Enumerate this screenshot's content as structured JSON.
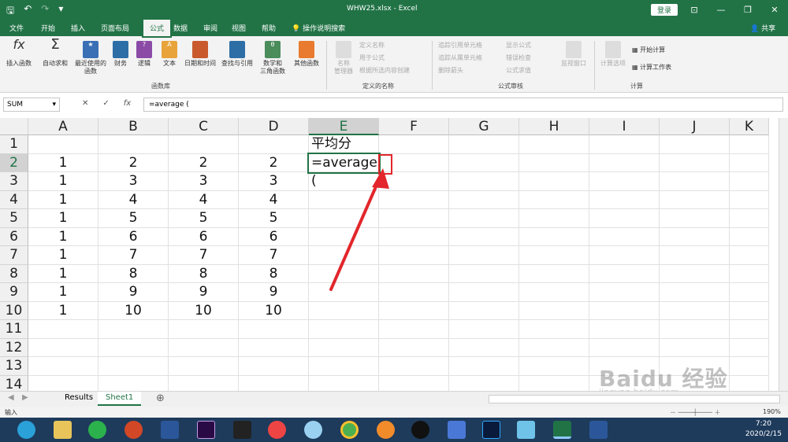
{
  "titlebar": {
    "title": "WHW25.xlsx  -  Excel",
    "login_label": "登录"
  },
  "tabs": [
    "文件",
    "开始",
    "插入",
    "页面布局",
    "公式",
    "数据",
    "审阅",
    "视图",
    "帮助"
  ],
  "tell_me": "操作说明搜索",
  "share_label": "共享",
  "ribbon": {
    "buttons": [
      "插入函数",
      "自动求和",
      "最近使用的\n函数",
      "财务",
      "逻辑",
      "文本",
      "日期和时间",
      "查找与引用",
      "数学和\n三角函数",
      "其他函数",
      "名称\n管理器"
    ],
    "defined_names": [
      "定义名称",
      "用于公式",
      "根据所选内容创建"
    ],
    "audit": [
      "追踪引用单元格",
      "追踪从属单元格",
      "删除箭头",
      "显示公式",
      "错误检查",
      "公式求值"
    ],
    "watch": "监视窗口",
    "calc_options": "计算选项",
    "calc_now": "开始计算",
    "calc_sheet": "计算工作表",
    "group_labels": [
      "函数库",
      "定义的名称",
      "公式审核",
      "计算"
    ]
  },
  "formula_bar": {
    "name_box": "SUM",
    "fx_label": "fx",
    "content": "=average ("
  },
  "columns": [
    "A",
    "B",
    "C",
    "D",
    "E",
    "F",
    "G",
    "H",
    "I",
    "J",
    "K"
  ],
  "rows": [
    "1",
    "2",
    "3",
    "4",
    "5",
    "6",
    "7",
    "8",
    "9",
    "10",
    "11",
    "12",
    "13",
    "14"
  ],
  "cells": {
    "E1": "平均分",
    "E2": "=average (",
    "data": [
      [
        "1",
        "2",
        "2",
        "2"
      ],
      [
        "1",
        "3",
        "3",
        "3"
      ],
      [
        "1",
        "4",
        "4",
        "4"
      ],
      [
        "1",
        "5",
        "5",
        "5"
      ],
      [
        "1",
        "6",
        "6",
        "6"
      ],
      [
        "1",
        "7",
        "7",
        "7"
      ],
      [
        "1",
        "8",
        "8",
        "8"
      ],
      [
        "1",
        "9",
        "9",
        "9"
      ],
      [
        "1",
        "10",
        "10",
        "10"
      ]
    ]
  },
  "sheets": [
    "Results",
    "Sheet1"
  ],
  "active_sheet": "Sheet1",
  "status": {
    "mode": "输入",
    "zoom": "190%"
  },
  "clock": {
    "time": "7:20",
    "date": "2020/2/15"
  },
  "watermark": {
    "main": "Baidu 经验",
    "sub": "jingyan.baidu.com"
  },
  "accent": "#217346",
  "annotation_color": "#e2262b"
}
